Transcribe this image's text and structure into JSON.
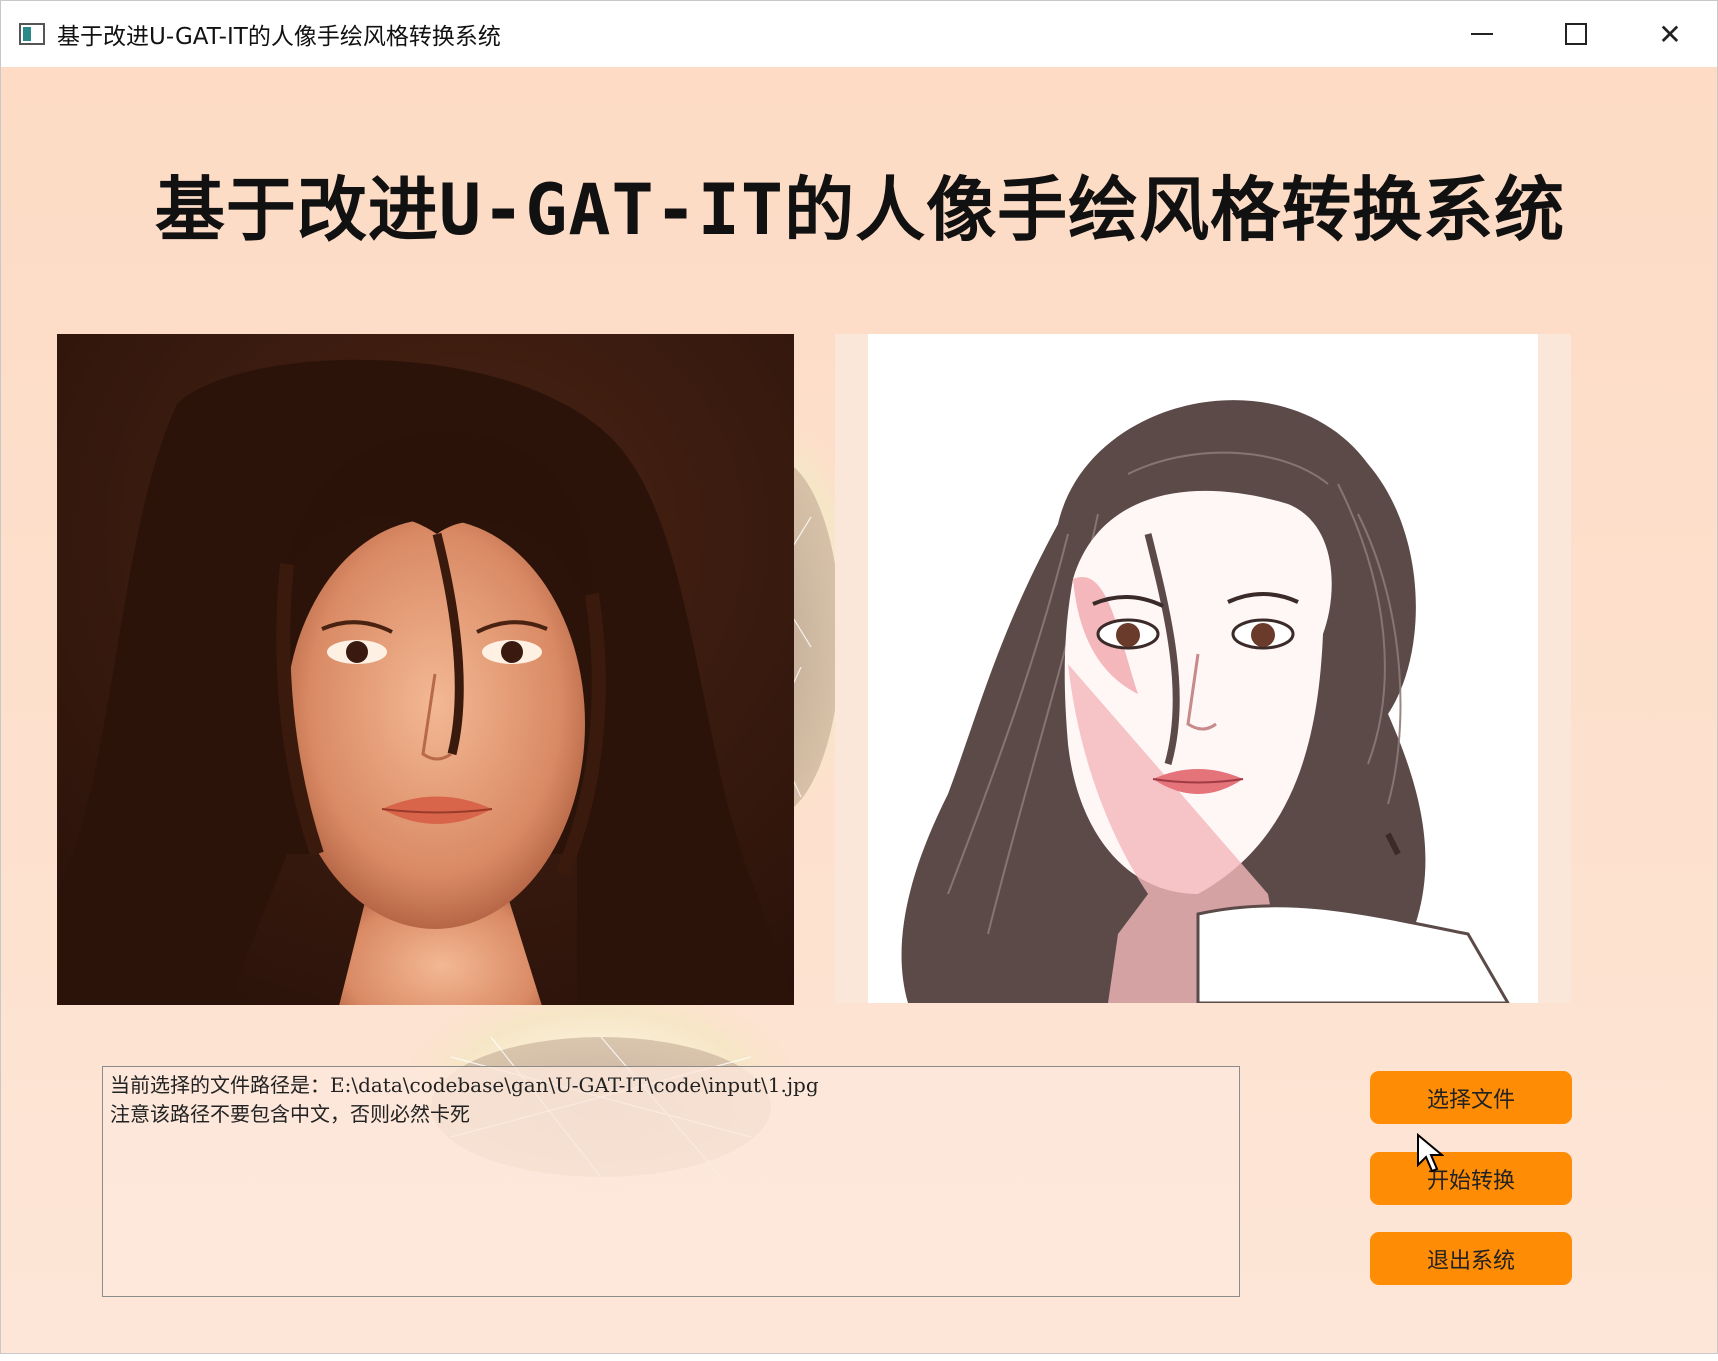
{
  "window": {
    "title": "基于改进U-GAT-IT的人像手绘风格转换系统",
    "minimize_glyph": "—",
    "close_glyph": "✕"
  },
  "main": {
    "heading": "基于改进U-GAT-IT的人像手绘风格转换系统"
  },
  "log": {
    "lines": [
      "当前选择的文件路径是：E:\\data\\codebase\\gan\\U-GAT-IT\\code\\input\\1.jpg",
      "注意该路径不要包含中文，否则必然卡死"
    ]
  },
  "buttons": {
    "select_file": "选择文件",
    "start_convert": "开始转换",
    "exit_system": "退出系统"
  },
  "colors": {
    "background": "#fddcc6",
    "button": "#fe8c05",
    "titlebar": "#ffffff"
  },
  "icons": [
    "app-icon",
    "minimize-icon",
    "maximize-icon",
    "close-icon",
    "mouse-cursor-icon"
  ]
}
